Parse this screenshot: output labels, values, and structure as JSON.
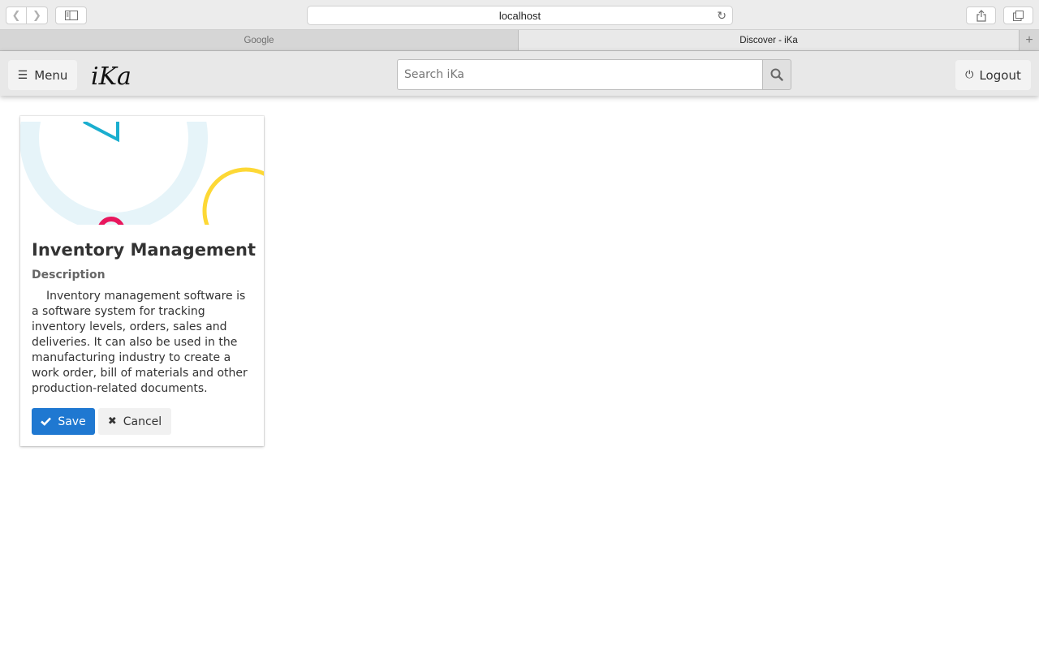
{
  "browser": {
    "address": "localhost",
    "tabs": [
      {
        "label": "Google",
        "active": false
      },
      {
        "label": "Discover - iKa",
        "active": true
      }
    ],
    "new_tab_label": "+"
  },
  "header": {
    "menu_label": "Menu",
    "logo": "iKa",
    "search_placeholder": "Search iKa",
    "logout_label": "Logout"
  },
  "card": {
    "title": "Inventory Management",
    "description_label": "Description",
    "description": "Inventory management software is a software system for tracking inventory levels, orders, sales and deliveries. It can also be used in the manufacturing industry to create a work order, bill of materials and other production-related documents.",
    "save_label": "Save",
    "cancel_label": "Cancel"
  },
  "colors": {
    "primary": "#1f78d1",
    "header_bg": "#e8e8e8",
    "decor_teal": "#1aaecf",
    "decor_light_blue": "#e6f4f9",
    "decor_yellow": "#fdd835",
    "decor_pink": "#e8175d"
  },
  "icons": {
    "menu": "hamburger-icon",
    "search": "search-icon",
    "logout": "power-icon",
    "save": "check-icon",
    "cancel": "close-icon"
  }
}
